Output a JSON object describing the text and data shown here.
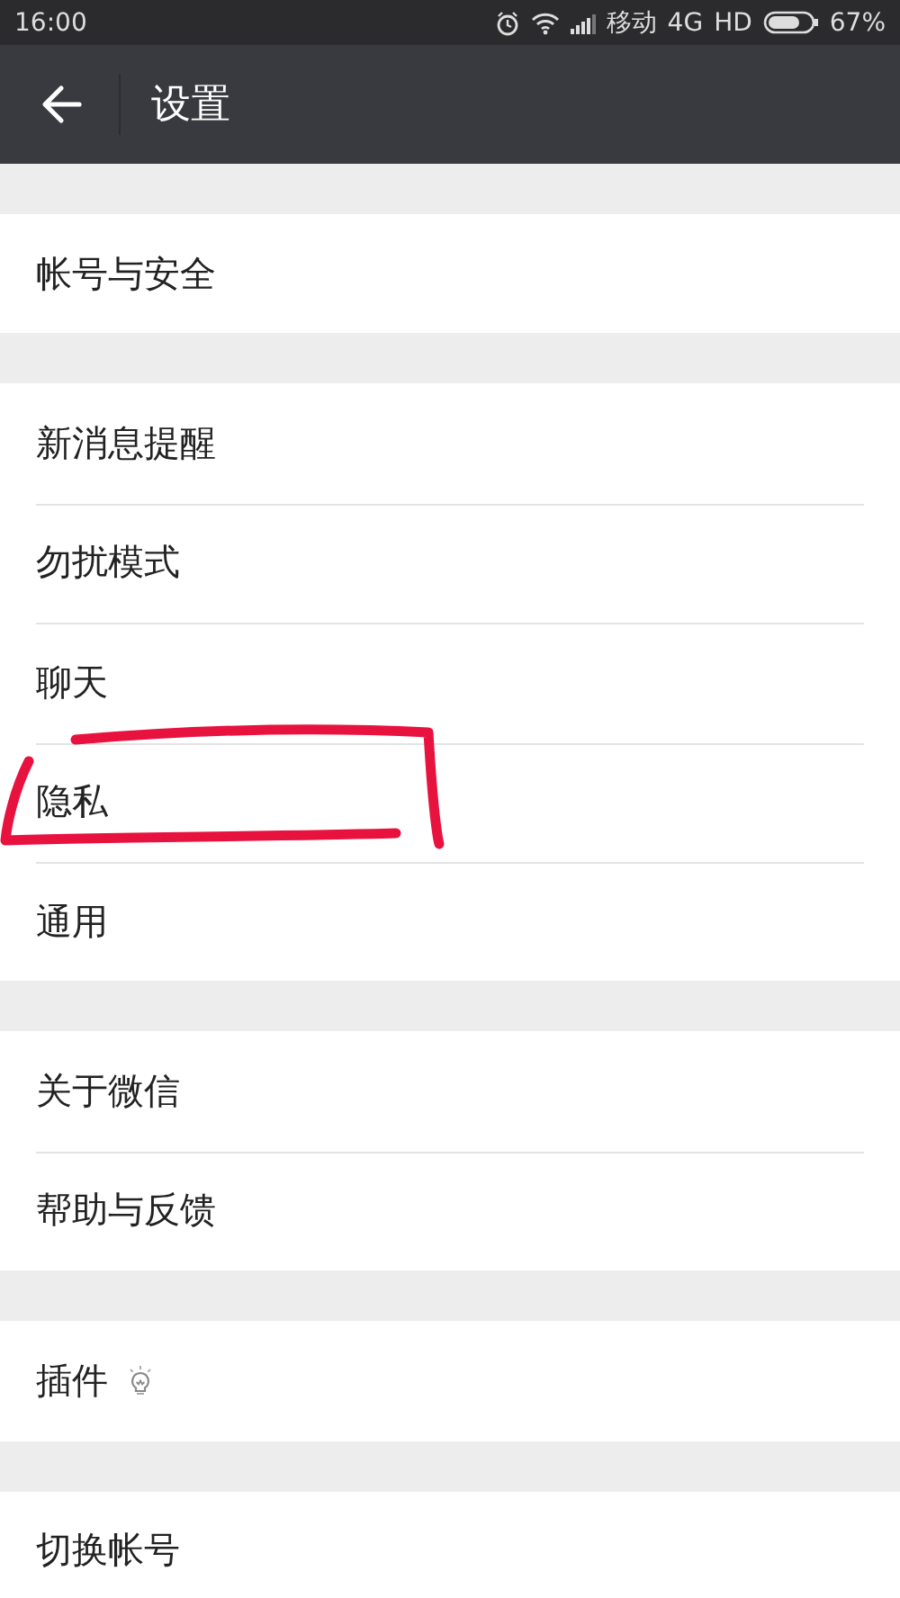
{
  "status_bar": {
    "time": "16:00",
    "carrier": "移动",
    "network": "4G",
    "hd": "HD",
    "battery": "67%"
  },
  "toolbar": {
    "title": "设置"
  },
  "groups": [
    {
      "items": [
        {
          "label": "帐号与安全",
          "kind": "plain",
          "annotated": false
        }
      ]
    },
    {
      "items": [
        {
          "label": "新消息提醒",
          "kind": "plain",
          "annotated": false
        },
        {
          "label": "勿扰模式",
          "kind": "plain",
          "annotated": false
        },
        {
          "label": "聊天",
          "kind": "plain",
          "annotated": false
        },
        {
          "label": "隐私",
          "kind": "plain",
          "annotated": true
        },
        {
          "label": "通用",
          "kind": "plain",
          "annotated": false
        }
      ]
    },
    {
      "items": [
        {
          "label": "关于微信",
          "kind": "plain",
          "annotated": false
        },
        {
          "label": "帮助与反馈",
          "kind": "plain",
          "annotated": false
        }
      ]
    },
    {
      "items": [
        {
          "label": "插件",
          "kind": "bulb",
          "annotated": false
        }
      ]
    },
    {
      "items": [
        {
          "label": "切换帐号",
          "kind": "plain",
          "annotated": false
        }
      ]
    }
  ]
}
